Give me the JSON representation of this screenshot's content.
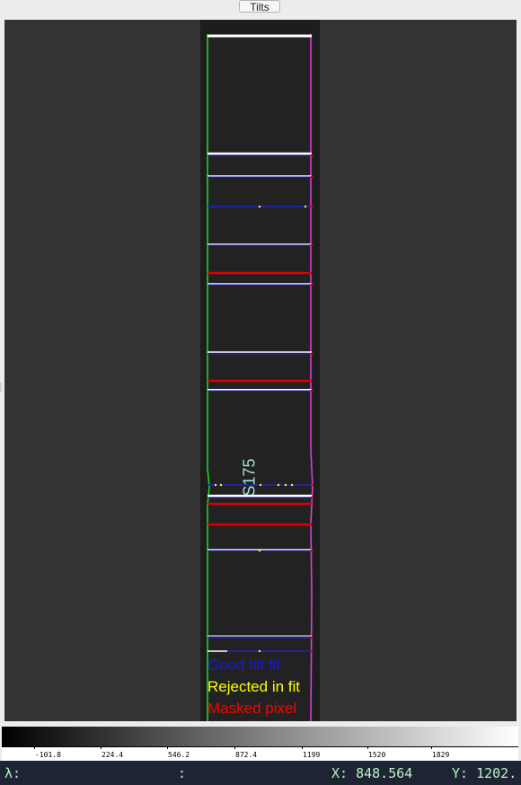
{
  "window": {
    "tab_title": "Tilts"
  },
  "slit": {
    "label": "S175"
  },
  "legend": [
    {
      "text": "Good tilt fit",
      "color": "#1a1acc"
    },
    {
      "text": "Rejected in fit",
      "color": "#ffff00"
    },
    {
      "text": "Masked pixel",
      "color": "#ff0000"
    }
  ],
  "colors": {
    "edge_left": "#22dd22",
    "edge_right": "#e040e0",
    "good_fit": "#2323c8",
    "rejected": "#ffff00",
    "masked": "#e00000",
    "arc_line": "#ffffff"
  },
  "colorbar": {
    "ticks": [
      "-101.8",
      "224.4",
      "546.2",
      "872.4",
      "1199",
      "1520",
      "1829"
    ]
  },
  "status": {
    "lambda_label": "λ:",
    "separator": ":",
    "x_label": "X: 848.564",
    "y_label": "Y: 1202."
  }
}
